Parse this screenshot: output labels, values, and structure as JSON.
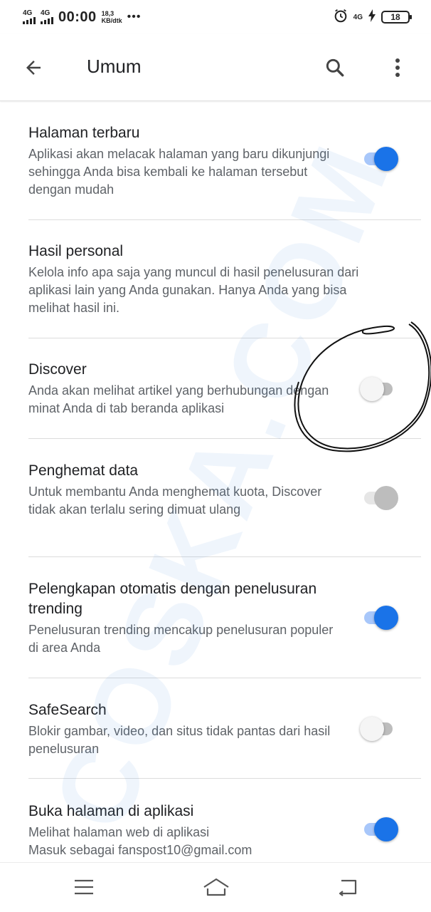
{
  "status_bar": {
    "sim1_label": "4G",
    "sim2_label": "4G",
    "time": "00:00",
    "speed_value": "18,3",
    "speed_unit": "KB/dtk",
    "more_dots": "•••",
    "right_network_label": "4G",
    "battery_level": "18"
  },
  "app_bar": {
    "title": "Umum"
  },
  "settings": [
    {
      "title": "Halaman terbaru",
      "description": "Aplikasi akan melacak halaman yang baru dikunjungi sehingga Anda bisa kembali ke halaman tersebut dengan mudah",
      "toggle": "on"
    },
    {
      "title": "Hasil personal",
      "description": "Kelola info apa saja yang muncul di hasil penelusuran dari aplikasi lain yang Anda gunakan. Hanya Anda yang bisa melihat hasil ini."
    },
    {
      "title": "Discover",
      "description": "Anda akan melihat artikel yang berhubungan dengan minat Anda di tab beranda aplikasi",
      "toggle": "off"
    },
    {
      "title": "Penghemat data",
      "description": "Untuk membantu Anda menghemat kuota, Discover tidak akan terlalu sering dimuat ulang",
      "toggle": "on-disabled"
    },
    {
      "title": "Pelengkapan otomatis dengan penelusuran trending",
      "description": "Penelusuran trending mencakup penelusuran populer di area Anda",
      "toggle": "on"
    },
    {
      "title": "SafeSearch",
      "description": "Blokir gambar, video, dan situs tidak pantas dari hasil penelusuran",
      "toggle": "off"
    },
    {
      "title": "Buka halaman di aplikasi",
      "description": "Melihat halaman web di aplikasi",
      "account_line": "Masuk sebagai fanspost10@gmail.com",
      "toggle": "on"
    }
  ],
  "watermark": {
    "text": "COSKA.COM"
  },
  "colors": {
    "accent": "#1a73e8",
    "accent_track": "#a8c7fa",
    "text_primary": "#202124",
    "text_secondary": "#5f6368",
    "watermark": "#4a90d9"
  },
  "icons": {
    "back": "arrow-left-icon",
    "search": "search-icon",
    "more": "more-vert-icon",
    "nav_menu": "menu-icon",
    "nav_home": "home-icon",
    "nav_back": "back-icon"
  }
}
